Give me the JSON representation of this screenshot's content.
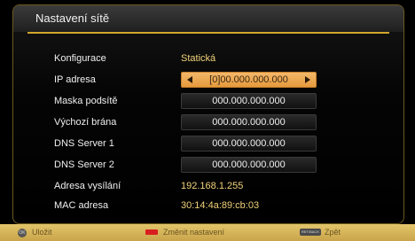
{
  "window": {
    "title": "Nastavení sítě"
  },
  "rows": [
    {
      "label": "Konfigurace",
      "value": "Statická"
    },
    {
      "label": "IP adresa",
      "value": "[0]00.000.000.000"
    },
    {
      "label": "Maska podsítě",
      "value": "000.000.000.000"
    },
    {
      "label": "Výchozí brána",
      "value": "000.000.000.000"
    },
    {
      "label": "DNS Server 1",
      "value": "000.000.000.000"
    },
    {
      "label": "DNS Server 2",
      "value": "000.000.000.000"
    },
    {
      "label": "Adresa vysílání",
      "value": "192.168.1.255"
    },
    {
      "label": "MAC adresa",
      "value": "30:14:4a:89:cb:03"
    }
  ],
  "footer": {
    "ok_icon_text": "OK",
    "save_label": "Uložit",
    "change_label": "Změnit nastavení",
    "back_key_text": "RET/BACK",
    "back_label": "Zpět"
  },
  "colors": {
    "accent_gold": "#d3a62a",
    "config_value": "#f1d27a",
    "readonly_value": "#f1d27a",
    "selected_field": "#ecab55",
    "footer_bg": "#d8b95a",
    "change_key": "#d81e1e"
  }
}
